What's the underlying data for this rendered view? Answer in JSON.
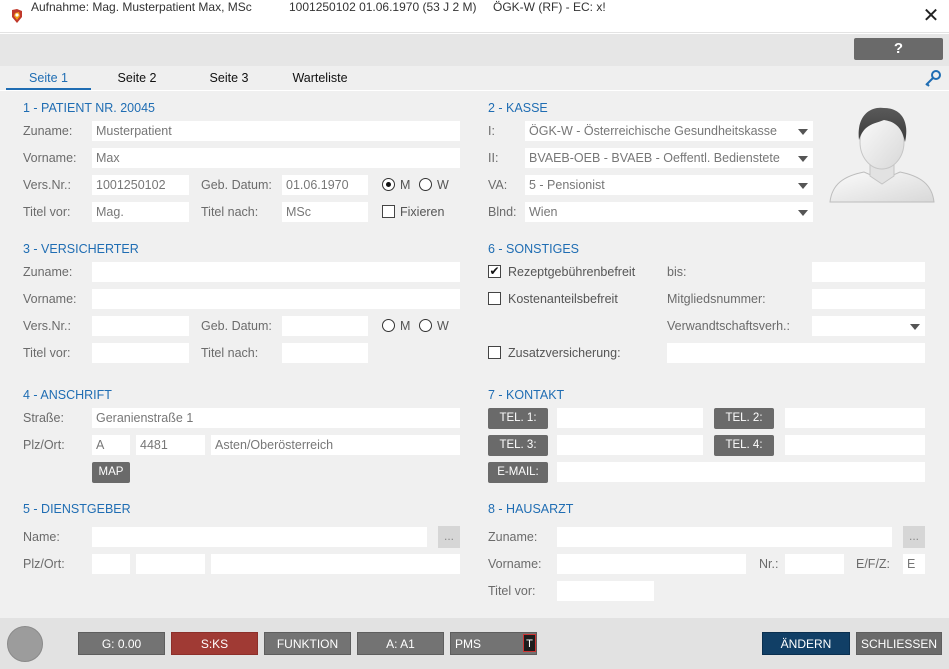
{
  "window": {
    "title": "Aufnahme: Mag. Musterpatient Max, MSc",
    "patient_info": "1001250102 01.06.1970 (53 J 2 M)",
    "insurance_info": "ÖGK-W (RF) - EC: x!",
    "close_glyph": "✕"
  },
  "toolbar": {
    "help_label": "?"
  },
  "tabs": [
    {
      "label": "Seite 1",
      "active": true
    },
    {
      "label": "Seite 2",
      "active": false
    },
    {
      "label": "Seite 3",
      "active": false
    },
    {
      "label": "Warteliste",
      "active": false
    }
  ],
  "patient": {
    "heading": "1 - PATIENT NR. 20045",
    "zuname_label": "Zuname:",
    "zuname": "Musterpatient",
    "vorname_label": "Vorname:",
    "vorname": "Max",
    "versnr_label": "Vers.Nr.:",
    "versnr": "1001250102",
    "gebdatum_label": "Geb. Datum:",
    "gebdatum": "01.06.1970",
    "sex_m": "M",
    "sex_w": "W",
    "sex_selected": "M",
    "titel_vor_label": "Titel vor:",
    "titel_vor": "Mag.",
    "titel_nach_label": "Titel nach:",
    "titel_nach": "MSc",
    "fixieren_label": "Fixieren",
    "fixieren_checked": false
  },
  "kasse": {
    "heading": "2 - KASSE",
    "k1_label": "I:",
    "k1": "ÖGK-W - Österreichische Gesundheitskasse",
    "k2_label": "II:",
    "k2": "BVAEB-OEB - BVAEB - Oeffentl. Bedienstete",
    "va_label": "VA:",
    "va": "5 - Pensionist",
    "blnd_label": "Blnd:",
    "blnd": "Wien"
  },
  "versicherter": {
    "heading": "3 - VERSICHERTER",
    "zuname_label": "Zuname:",
    "vorname_label": "Vorname:",
    "versnr_label": "Vers.Nr.:",
    "gebdatum_label": "Geb. Datum:",
    "sex_m": "M",
    "sex_w": "W",
    "titel_vor_label": "Titel vor:",
    "titel_nach_label": "Titel nach:"
  },
  "sonstiges": {
    "heading": "6 - SONSTIGES",
    "rezept_label": "Rezeptgebührenbefreit",
    "rezept_checked": true,
    "bis_label": "bis:",
    "kosten_label": "Kostenanteilsbefreit",
    "kosten_checked": false,
    "mitglied_label": "Mitgliedsnummer:",
    "verwandt_label": "Verwandtschaftsverh.:",
    "zusatz_label": "Zusatzversicherung:",
    "zusatz_checked": false
  },
  "anschrift": {
    "heading": "4 - ANSCHRIFT",
    "strasse_label": "Straße:",
    "strasse": "Geranienstraße 1",
    "plzort_label": "Plz/Ort:",
    "land": "A",
    "plz": "4481",
    "ort": "Asten/Oberösterreich",
    "map_label": "MAP"
  },
  "kontakt": {
    "heading": "7 - KONTAKT",
    "tel1": "TEL. 1:",
    "tel2": "TEL. 2:",
    "tel3": "TEL. 3:",
    "tel4": "TEL. 4:",
    "email": "E-MAIL:"
  },
  "dienstgeber": {
    "heading": "5 - DIENSTGEBER",
    "name_label": "Name:",
    "plzort_label": "Plz/Ort:",
    "dots": "..."
  },
  "hausarzt": {
    "heading": "8 - HAUSARZT",
    "zuname_label": "Zuname:",
    "vorname_label": "Vorname:",
    "nr_label": "Nr.:",
    "efz_label": "E/F/Z:",
    "efz": "E",
    "titel_vor_label": "Titel vor:",
    "dots": "..."
  },
  "bottom": {
    "g": "G: 0.00",
    "sks": "S:KS",
    "funktion": "FUNKTION",
    "a": "A: A1",
    "pms": "PMS",
    "t": "T",
    "aendern": "ÄNDERN",
    "schliessen": "SCHLIESSEN"
  },
  "colors": {
    "accent": "#1f6db3",
    "aendern": "#113f66",
    "sks": "#a03a34",
    "button_grey": "#737373"
  },
  "icons": [
    "app-icon",
    "close-icon",
    "help-icon",
    "key-icon",
    "avatar",
    "dropdown-arrow-icon"
  ]
}
